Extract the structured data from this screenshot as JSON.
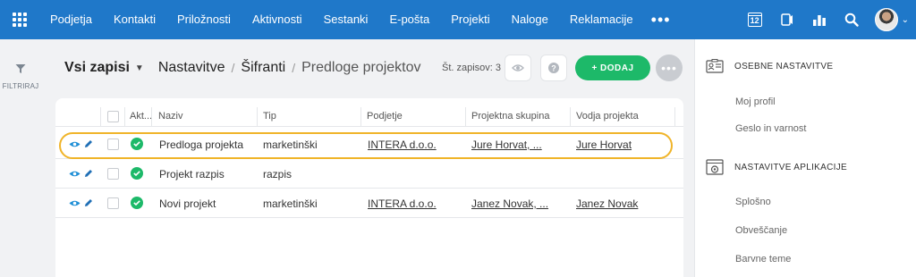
{
  "topnav": {
    "items": [
      "Podjetja",
      "Kontakti",
      "Priložnosti",
      "Aktivnosti",
      "Sestanki",
      "E-pošta",
      "Projekti",
      "Naloge",
      "Reklamacije"
    ],
    "more": "•••",
    "calendar_day": "12"
  },
  "sidebar": {
    "filter_label": "FILTRIRAJ"
  },
  "header": {
    "view_selector": "Vsi zapisi",
    "breadcrumb": [
      "Nastavitve",
      "Šifranti",
      "Predloge projektov"
    ],
    "record_count": "Št. zapisov: 3",
    "add_button": "+ DODAJ"
  },
  "table": {
    "columns": [
      "Akt...",
      "Naziv",
      "Tip",
      "Podjetje",
      "Projektna skupina",
      "Vodja projekta"
    ],
    "rows": [
      {
        "naziv": "Predloga projekta",
        "tip": "marketinški",
        "podjetje": "INTERA d.o.o.",
        "skupina": "Jure Horvat, ...",
        "vodja": "Jure Horvat",
        "active": true,
        "highlighted": true
      },
      {
        "naziv": "Projekt razpis",
        "tip": "razpis",
        "podjetje": "",
        "skupina": "",
        "vodja": "",
        "active": true,
        "highlighted": false
      },
      {
        "naziv": "Novi projekt",
        "tip": "marketinški",
        "podjetje": "INTERA d.o.o.",
        "skupina": "Janez Novak, ...",
        "vodja": "Janez Novak",
        "active": true,
        "highlighted": false
      }
    ]
  },
  "right_panel": {
    "sections": [
      {
        "title": "OSEBNE NASTAVITVE",
        "items": [
          "Moj profil",
          "Geslo in varnost"
        ]
      },
      {
        "title": "NASTAVITVE APLIKACIJE",
        "items": [
          "Splošno",
          "Obveščanje",
          "Barvne teme"
        ]
      }
    ]
  },
  "colors": {
    "topbar": "#1f78c9",
    "accent_green": "#1db969",
    "highlight": "#f0b429"
  },
  "icons": [
    "apps-grid-icon",
    "calendar-icon",
    "phone-icon",
    "bar-chart-icon",
    "search-icon",
    "filter-icon",
    "eye-icon",
    "help-icon",
    "view-icon",
    "edit-icon",
    "check-icon",
    "profile-card-icon",
    "app-settings-icon"
  ]
}
